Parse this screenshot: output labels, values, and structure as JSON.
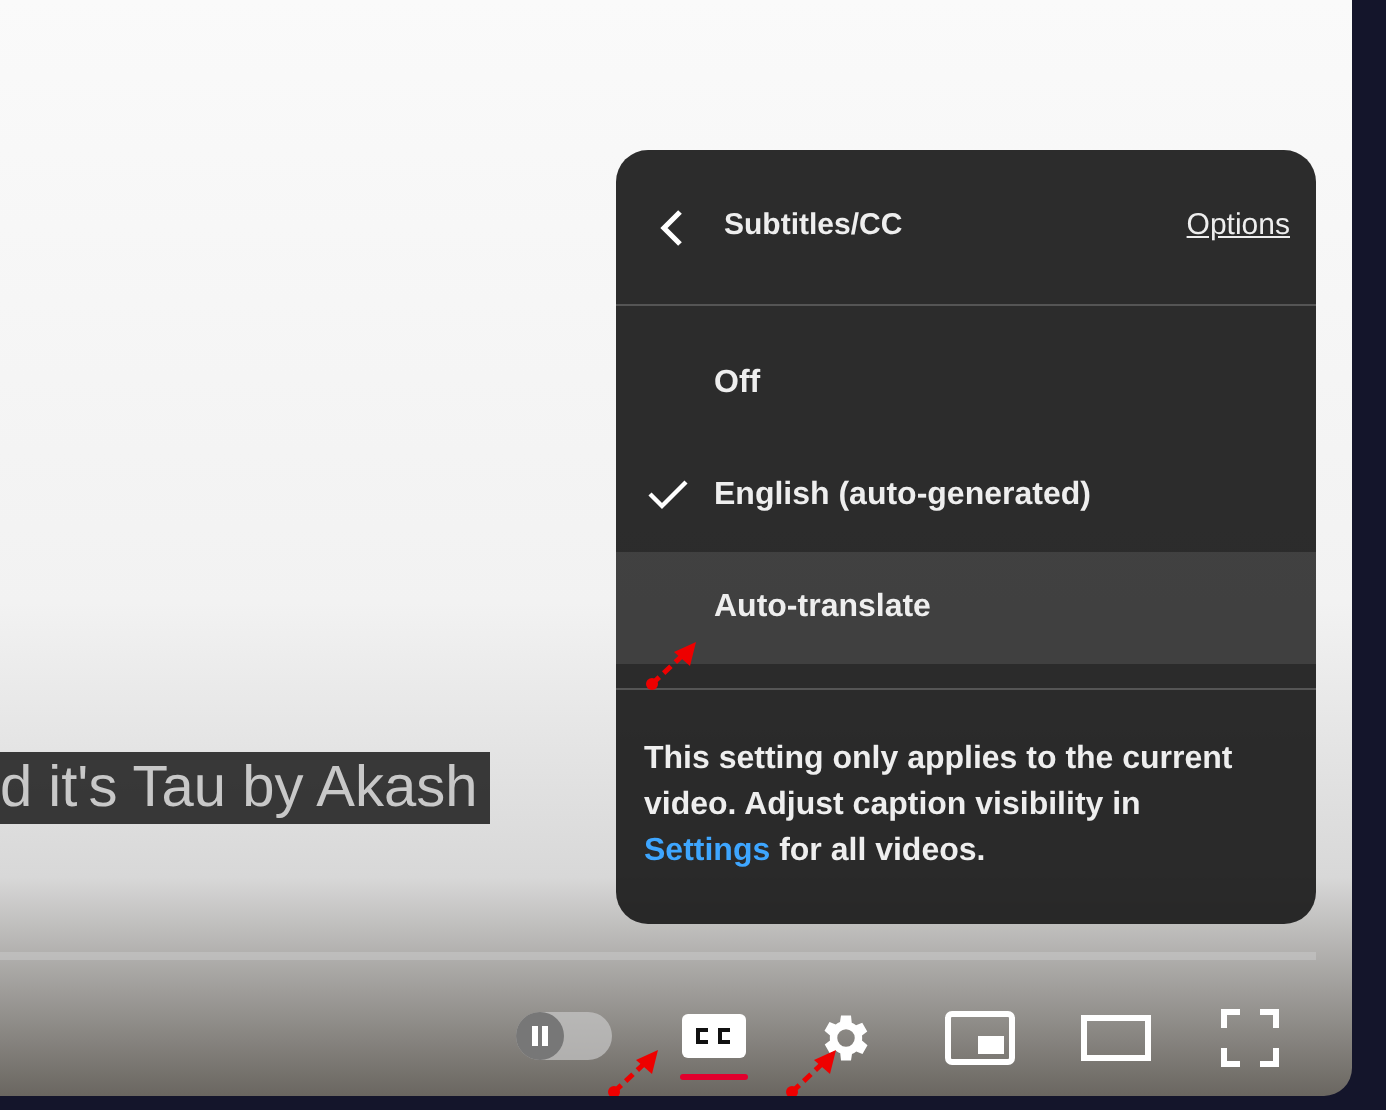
{
  "caption": {
    "text": "d it's Tau by Akash"
  },
  "menu": {
    "title": "Subtitles/CC",
    "options_link": "Options",
    "items": [
      {
        "label": "Off",
        "selected": false,
        "highlighted": false
      },
      {
        "label": "English (auto-generated)",
        "selected": true,
        "highlighted": false
      },
      {
        "label": "Auto-translate",
        "selected": false,
        "highlighted": true
      }
    ],
    "note": "This setting only applies to the current video. Adjust caption visibility in",
    "note_link": "Settings",
    "note_end": "for all videos."
  },
  "controls": {
    "autoplay_on": false,
    "captions_on": true
  }
}
